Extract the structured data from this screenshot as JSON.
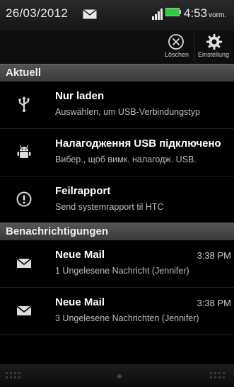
{
  "status_bar": {
    "date": "26/03/2012",
    "time": "4:53",
    "time_suffix": "vorm.",
    "icons": [
      "mail-icon",
      "signal-icon",
      "battery-icon"
    ],
    "battery_color": "#2ecc40"
  },
  "actions": {
    "clear_label": "Löschen",
    "settings_label": "Einstellung"
  },
  "sections": {
    "current": "Aktuell",
    "notifications": "Benachrichtigungen"
  },
  "current_items": [
    {
      "icon": "usb-icon",
      "title": "Nur laden",
      "subtitle": "Auswählen, um USB-Verbindungstyp"
    },
    {
      "icon": "android-debug-icon",
      "title": "Налагодження USB підключено",
      "subtitle": "Вибер., щоб вимк. налагодж. USB."
    },
    {
      "icon": "alert-icon",
      "title": "Feilrapport",
      "subtitle": "Send systemrapport til HTC"
    }
  ],
  "notification_items": [
    {
      "icon": "mail-icon",
      "title": "Neue Mail",
      "time": "3:38 PM",
      "subtitle": "1 Ungelesene Nachricht (Jennifer)"
    },
    {
      "icon": "mail-icon",
      "title": "Neue Mail",
      "time": "3:38 PM",
      "subtitle": "3 Ungelesene Nachrichten (Jennifer)"
    }
  ]
}
